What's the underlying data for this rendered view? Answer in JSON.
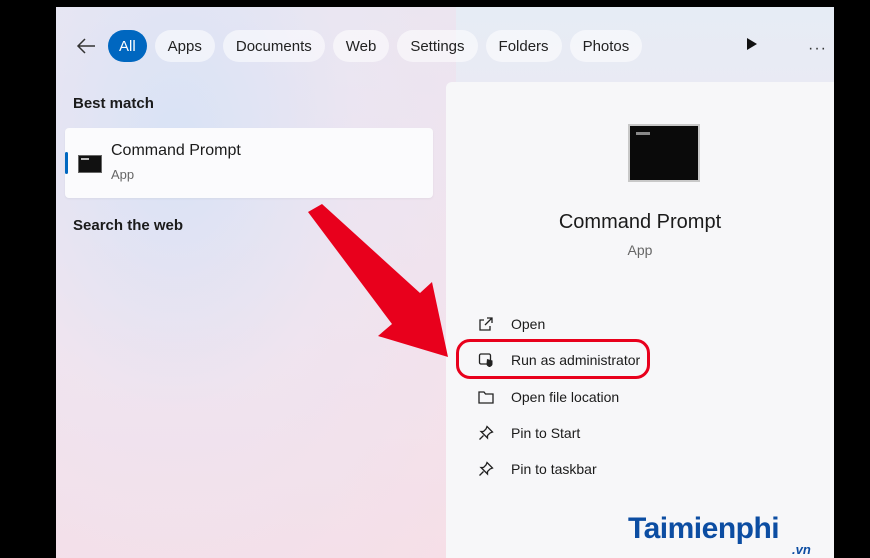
{
  "filter_tabs": [
    "All",
    "Apps",
    "Documents",
    "Web",
    "Settings",
    "Folders",
    "Photos"
  ],
  "sections": {
    "best_match": "Best match",
    "search_web": "Search the web"
  },
  "best_match_item": {
    "title": "Command Prompt",
    "subtitle": "App"
  },
  "detail": {
    "title": "Command Prompt",
    "subtitle": "App",
    "actions": [
      "Open",
      "Run as administrator",
      "Open file location",
      "Pin to Start",
      "Pin to taskbar"
    ]
  },
  "colors": {
    "accent": "#0067c0",
    "highlight_red": "#e8001c",
    "watermark": "#0c4da2"
  },
  "watermark": {
    "brand": "Taimienphi",
    "tld": ".vn"
  }
}
